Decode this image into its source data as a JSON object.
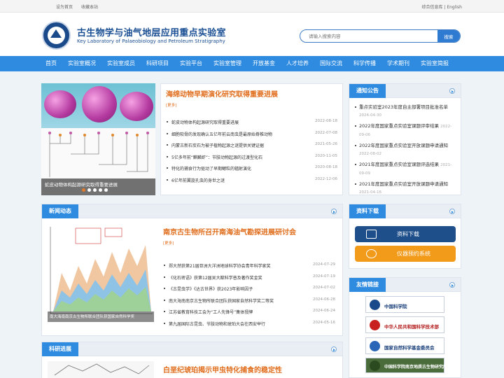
{
  "topbar": {
    "set_home": "设为首页",
    "bookmark": "收藏本站",
    "lang": "综合信息库 | English"
  },
  "header": {
    "title_cn": "古生物学与油气地层应用重点实验室",
    "title_en": "Key Laboratory of Palaeobiology and Petroleum Stratigraphy",
    "search_placeholder": "请输入搜索内容",
    "search_button": "搜索"
  },
  "nav": [
    "首页",
    "实验室概况",
    "实验室成员",
    "科研项目",
    "实验平台",
    "实验室管理",
    "开放基金",
    "人才培养",
    "国际交流",
    "科学传播",
    "学术期刊",
    "实验室简报"
  ],
  "slider": {
    "caption": "蛇皮动物体构起源研究取得重要进展",
    "dots": 5,
    "active_dot": 0
  },
  "top_news": {
    "headline": "海绵动物早期演化研究取得重要进展",
    "more": "[更多]",
    "items": [
      {
        "title": "蛇皮动物体构起源研究取得重要进展",
        "date": "2022-08-18"
      },
      {
        "title": "细胞软骨的发现确认五亿年前云南虫是最原始脊椎动物",
        "date": "2022-07-08"
      },
      {
        "title": "内蒙古新石炭石为被子植物起源之谜提供关键证据",
        "date": "2021-05-26"
      },
      {
        "title": "5亿多年前“麒麟虾”：节肢动物起源的过渡型化石",
        "date": "2020-11-05"
      },
      {
        "title": "特化的捕食行为驱动了早期鳃粒的辐射演化",
        "date": "2020-08-18"
      },
      {
        "title": "6亿年前翼旋孔虫的身世之谜",
        "date": "2022-12-06"
      }
    ]
  },
  "notice": {
    "title": "通知公告",
    "items": [
      {
        "title": "重点实验室2023年度自主部署项目批准名单",
        "date": "2024-04-30"
      },
      {
        "title": "2022年度国家重点实验室课题评审结果",
        "date": "2022-09-06"
      },
      {
        "title": "2022年度国家重点实验室开放课题申请通知",
        "date": "2022-08-02"
      },
      {
        "title": "2021年度国家重点实验室课题评选结果",
        "date": "2021-09-09"
      },
      {
        "title": "2021年度国家重点实验室开放课题申请通知",
        "date": "2021-04-16"
      }
    ]
  },
  "news": {
    "title": "新闻动态",
    "headline": "南京古生物所召开南海油气勘探进展研讨会",
    "more": "[更多]",
    "image_caption": "南大海南南京古生物所联合团队获国家自然科学奖",
    "items": [
      {
        "title": "郑大然获第21届亚洲大洋洲地球科学协会青年科学家奖",
        "date": "2024-07-29"
      },
      {
        "title": "《化石密语》获第12届吴大猷科学普及著作奖金奖",
        "date": "2024-07-19"
      },
      {
        "title": "《古昆虫学》《达古世界》获2023年影响因子",
        "date": "2024-07-02"
      },
      {
        "title": "南大海南南京古生物所联合团队获国家自然科学奖二等奖",
        "date": "2024-06-28"
      },
      {
        "title": "江苏省教育科技工会为“工人先锋号”集体授牌",
        "date": "2024-06-24"
      },
      {
        "title": "第九届国际古昆虫、节肢动物和琥珀大会在西安举行",
        "date": "2024-05-16"
      }
    ]
  },
  "resources": {
    "title": "资料下载",
    "download": "资料下载",
    "booking": "仪器预约系统"
  },
  "friend_links": {
    "title": "友情链接",
    "items": [
      "中国科学院",
      "中华人民共和国科学技术部",
      "国家自然科学基金委员会",
      "中国科学院南京地质古生物研究所"
    ]
  },
  "research": {
    "title": "科研进展",
    "headline": "白垩纪琥珀揭示甲虫特化捕食的稳定性"
  },
  "colors": {
    "primary": "#2e8be0",
    "accent": "#e06d1c",
    "brand_dark": "#1b4f93",
    "download_btn": "#1f4f8a",
    "booking_btn": "#f29a1a"
  }
}
